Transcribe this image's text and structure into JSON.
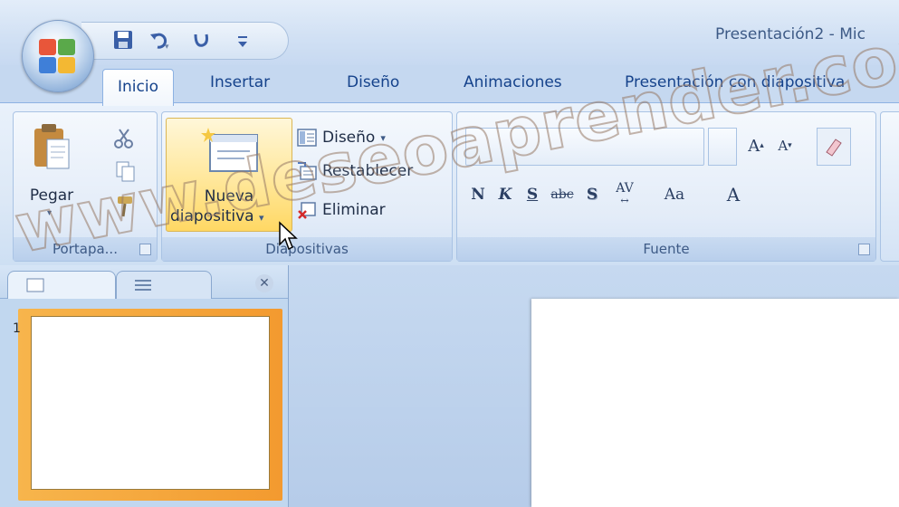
{
  "title_bar": {
    "document_title": "Presentación2 - Mic",
    "quick_access": [
      "save-icon",
      "undo-icon",
      "redo-icon",
      "customize-icon"
    ]
  },
  "tabs": [
    {
      "label": "Inicio",
      "active": true
    },
    {
      "label": "Insertar"
    },
    {
      "label": "Diseño"
    },
    {
      "label": "Animaciones"
    },
    {
      "label": "Presentación con diapositiva"
    }
  ],
  "ribbon": {
    "clipboard": {
      "paste_label": "Pegar",
      "group_label": "Portapa..."
    },
    "slides": {
      "new_slide_line1": "Nueva",
      "new_slide_line2": "diapositiva",
      "layout_label": "Diseño",
      "reset_label": "Restablecer",
      "delete_label": "Eliminar",
      "group_label": "Diapositivas"
    },
    "font": {
      "group_label": "Fuente",
      "buttons": [
        "N",
        "K",
        "S",
        "abc",
        "S",
        "AV",
        "Aa",
        "A"
      ]
    }
  },
  "watermark": "www.deseoaprender.com",
  "slide_panel": {
    "slide_number": "1"
  },
  "colors": {
    "accent": "#ffd864",
    "tab_text": "#15428b",
    "ribbon": "#dce8f6"
  }
}
